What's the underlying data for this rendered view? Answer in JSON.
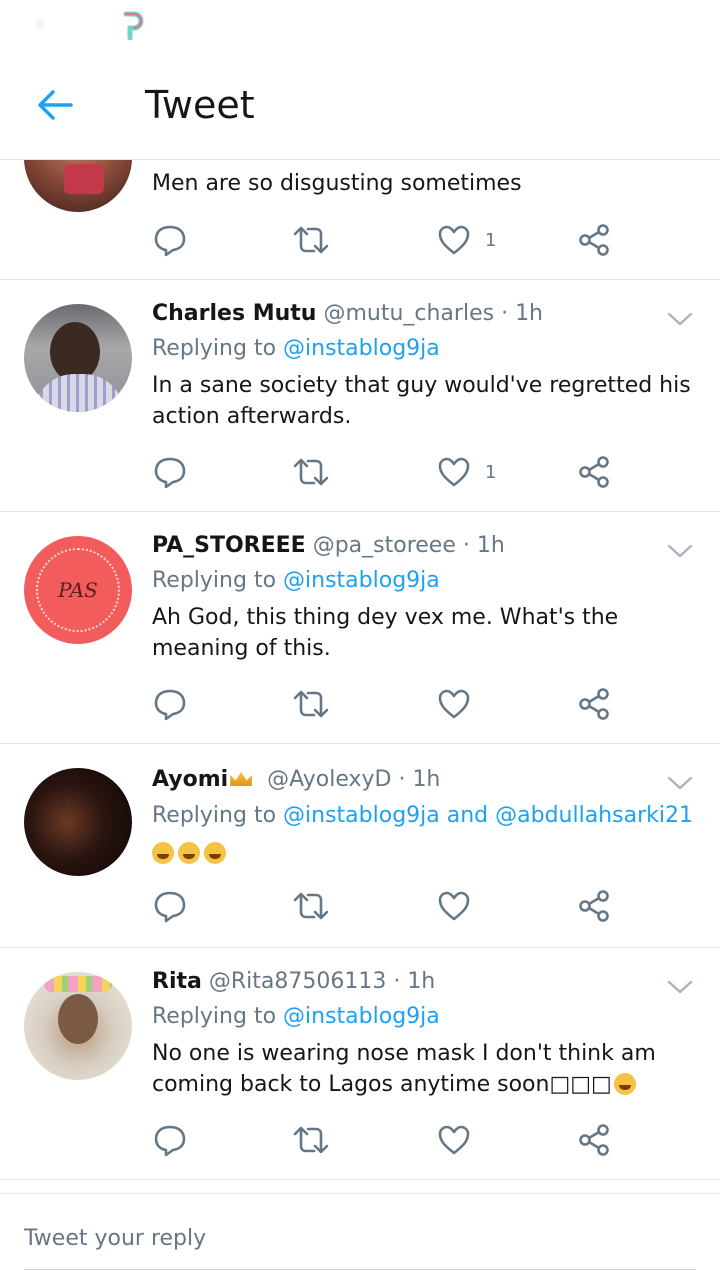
{
  "header": {
    "title": "Tweet"
  },
  "tweets": [
    {
      "body": "Men are so disgusting sometimes",
      "reply_count": "",
      "like_count": "1"
    },
    {
      "name": "Charles Mutu",
      "handle": "@mutu_charles",
      "time": "· 1h",
      "replying_prefix": "Replying to",
      "replying_to": "@instablog9ja",
      "body": "In a sane society that guy would've regretted his action afterwards.",
      "like_count": "1"
    },
    {
      "name": "PA_STOREEE",
      "handle": "@pa_storeee",
      "time": "· 1h",
      "replying_prefix": "Replying to",
      "replying_to": "@instablog9ja",
      "avatar_text": "PAS",
      "body": "Ah God, this thing dey vex me. What's the meaning of this.",
      "like_count": ""
    },
    {
      "name": "Ayomi",
      "handle": "@AyolexyD",
      "time": "· 1h",
      "replying_prefix": "Replying to",
      "replying_to": "@instablog9ja and @abdullahsarki21",
      "emoji_count": 3,
      "like_count": ""
    },
    {
      "name": "Rita",
      "handle": "@Rita87506113",
      "time": "· 1h",
      "replying_prefix": "Replying to",
      "replying_to": "@instablog9ja",
      "body": "No one is wearing nose mask I don't think am coming back to Lagos anytime soon□□□",
      "like_count": ""
    }
  ],
  "reply": {
    "placeholder": "Tweet your reply"
  },
  "colors": {
    "accent": "#1da1f2",
    "secondary_text": "#657786",
    "divider": "#e1e8ed",
    "pas_avatar": "#f25c5c"
  },
  "icons": [
    "back-arrow-icon",
    "reply-icon",
    "retweet-icon",
    "like-icon",
    "share-icon",
    "chevron-down-icon"
  ]
}
